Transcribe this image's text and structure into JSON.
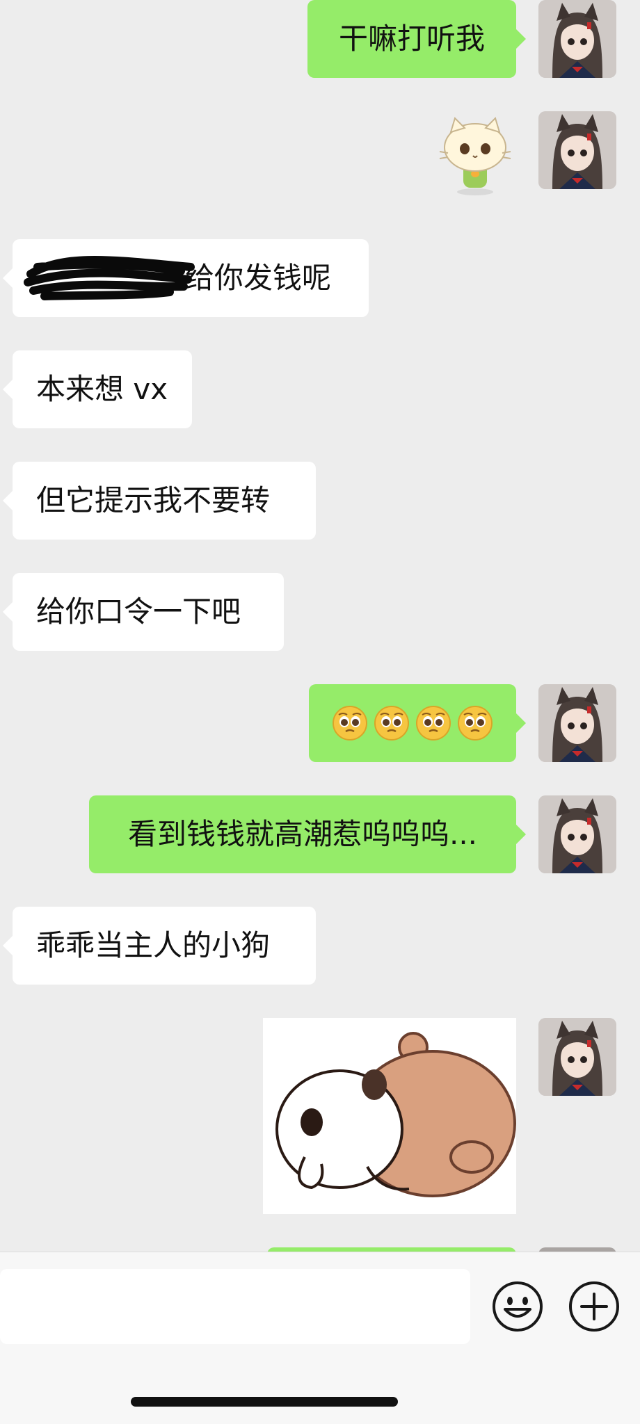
{
  "chat": {
    "messages": [
      {
        "text": "干嘛打听我"
      },
      {
        "sticker": "cat-sticker"
      },
      {
        "text": "给你发钱呢"
      },
      {
        "text": "本来想 vx"
      },
      {
        "text": "但它提示我不要转"
      },
      {
        "text": "给你口令一下吧"
      },
      {
        "emoji": "pleading-face",
        "count": 4
      },
      {
        "text": "看到钱钱就高潮惹呜呜呜..."
      },
      {
        "text": "乖乖当主人的小狗"
      },
      {
        "sticker": "bear-hug-sticker"
      }
    ]
  },
  "input_bar": {
    "emoji_icon": "smiley-icon",
    "plus_icon": "plus-circle-icon"
  }
}
